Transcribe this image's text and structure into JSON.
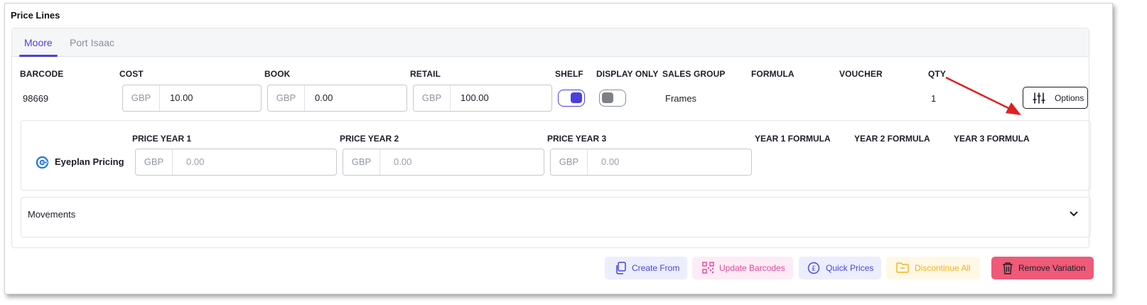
{
  "section": {
    "title": "Price Lines"
  },
  "tabs": [
    {
      "label": "Moore",
      "active": true
    },
    {
      "label": "Port Isaac",
      "active": false
    }
  ],
  "columns": {
    "barcode": "BARCODE",
    "cost": "COST",
    "book": "BOOK",
    "retail": "RETAIL",
    "shelf": "SHELF",
    "display_only": "DISPLAY ONLY",
    "sales_group": "SALES GROUP",
    "formula": "FORMULA",
    "voucher": "VOUCHER",
    "qty": "QTY"
  },
  "row": {
    "barcode": "98669",
    "cost": {
      "currency": "GBP",
      "value": "10.00"
    },
    "book": {
      "currency": "GBP",
      "value": "0.00"
    },
    "retail": {
      "currency": "GBP",
      "value": "100.00"
    },
    "shelf": true,
    "display_only": false,
    "sales_group": "Frames",
    "formula": "",
    "voucher": "",
    "qty": "1"
  },
  "options_button": {
    "label": "Options",
    "icon": "sliders-icon"
  },
  "eyeplan": {
    "label": "Eyeplan Pricing",
    "icon": "eyeplan-logo-icon",
    "headers": {
      "price_year_1": "PRICE YEAR 1",
      "price_year_2": "PRICE YEAR 2",
      "price_year_3": "PRICE YEAR 3",
      "year_1_formula": "YEAR 1 FORMULA",
      "year_2_formula": "YEAR 2 FORMULA",
      "year_3_formula": "YEAR 3 FORMULA"
    },
    "prices": [
      {
        "currency": "GBP",
        "placeholder": "0.00"
      },
      {
        "currency": "GBP",
        "placeholder": "0.00"
      },
      {
        "currency": "GBP",
        "placeholder": "0.00"
      }
    ]
  },
  "movements": {
    "label": "Movements"
  },
  "actions": [
    {
      "label": "Create From",
      "icon": "copy-icon",
      "color": "#4b3fdc"
    },
    {
      "label": "Update Barcodes",
      "icon": "qr-code-icon",
      "color": "#e0479a"
    },
    {
      "label": "Quick Prices",
      "icon": "pound-circle-icon",
      "color": "#4b3fdc"
    },
    {
      "label": "Discontinue All",
      "icon": "folder-minus-icon",
      "color": "#f2b21d"
    },
    {
      "label": "Remove Variation",
      "icon": "trash-icon",
      "color": "#ef5a78"
    }
  ],
  "colors": {
    "accent": "#4b3fdc",
    "annotation_arrow": "#e02020"
  }
}
